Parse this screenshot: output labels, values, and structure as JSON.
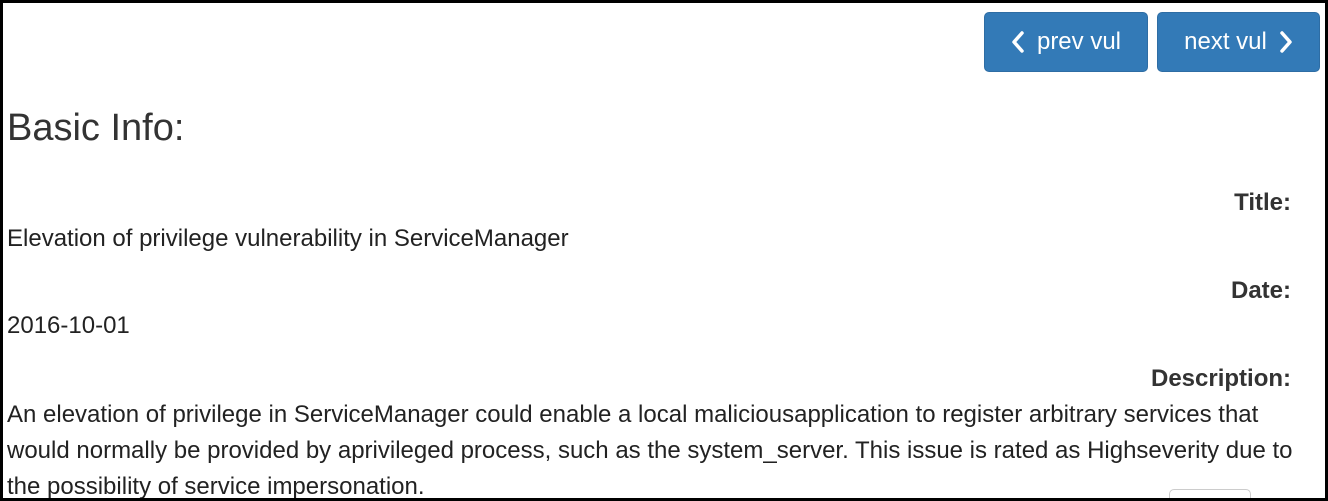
{
  "nav": {
    "prev_label": "prev vul",
    "next_label": "next vul"
  },
  "basic_info": {
    "heading": "Basic Info:",
    "title_label": "Title:",
    "title_value": "Elevation of privilege vulnerability in ServiceManager",
    "date_label": "Date:",
    "date_value": "2016-10-01",
    "description_label": "Description:",
    "description_value": "An elevation of privilege in ServiceManager could enable a local maliciousapplication to register arbitrary services that would normally be provided by aprivileged process, such as the system_server. This issue is rated as Highseverity due to the possibility of service impersonation."
  },
  "colors": {
    "button_bg": "#337ab7",
    "button_border": "#2e6da4",
    "text": "#333333"
  },
  "icons": [
    "chevron-left-icon",
    "chevron-right-icon"
  ]
}
